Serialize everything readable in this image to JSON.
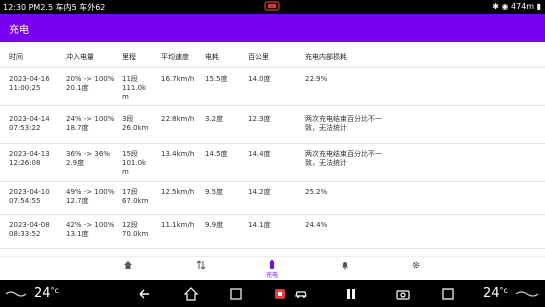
{
  "status_bar": {
    "left": "12:30 PM2.5 车内5 车外62",
    "right": "474m"
  },
  "app_bar": {
    "title": "充电"
  },
  "table": {
    "headers": [
      "时间",
      "冲入电量",
      "里程",
      "平均速度",
      "电耗",
      "百公里",
      "充电内部损耗"
    ],
    "rows": [
      {
        "date": "2023-04-16",
        "time": "11:00:25",
        "charge_pct": "20% -> 100%",
        "charge_amt": "20.1度",
        "mileage_seg": "11段",
        "mileage_km": "111.0k",
        "mileage_km2": "m",
        "speed": "16.7km/h",
        "consumption": "15.5度",
        "per100": "14.0度",
        "loss": "22.9%",
        "note": ""
      },
      {
        "date": "2023-04-14",
        "time": "07:53:22",
        "charge_pct": "24% -> 100%",
        "charge_amt": "18.7度",
        "mileage_seg": "3段",
        "mileage_km": "26.0km",
        "mileage_km2": "",
        "speed": "22.8km/h",
        "consumption": "3.2度",
        "per100": "12.3度",
        "loss": "",
        "note": "两次充电结束百分比不一致，无法统计"
      },
      {
        "date": "2023-04-13",
        "time": "12:26:08",
        "charge_pct": "36% -> 36%",
        "charge_amt": "2.9度",
        "mileage_seg": "15段",
        "mileage_km": "101.0k",
        "mileage_km2": "m",
        "speed": "13.4km/h",
        "consumption": "14.5度",
        "per100": "14.4度",
        "loss": "",
        "note": "两次充电结束百分比不一致，无法统计"
      },
      {
        "date": "2023-04-10",
        "time": "07:54:55",
        "charge_pct": "49% -> 100%",
        "charge_amt": "12.7度",
        "mileage_seg": "17段",
        "mileage_km": "67.0km",
        "mileage_km2": "",
        "speed": "12.5km/h",
        "consumption": "9.5度",
        "per100": "14.2度",
        "loss": "25.2%",
        "note": ""
      },
      {
        "date": "2023-04-08",
        "time": "08:33:52",
        "charge_pct": "42% -> 100%",
        "charge_amt": "13.1度",
        "mileage_seg": "12段",
        "mileage_km": "70.0km",
        "mileage_km2": "",
        "speed": "11.1km/h",
        "consumption": "9.9度",
        "per100": "14.1度",
        "loss": "24.4%",
        "note": ""
      }
    ]
  },
  "bottom_nav": [
    {
      "icon": "home-icon",
      "label": ""
    },
    {
      "icon": "swap-icon",
      "label": ""
    },
    {
      "icon": "battery-icon",
      "label": "充电",
      "active": true
    },
    {
      "icon": "bell-icon",
      "label": ""
    },
    {
      "icon": "gear-icon",
      "label": ""
    }
  ],
  "system_bar": {
    "temp_left": "24",
    "temp_right": "24",
    "unit": "°c"
  },
  "colors": {
    "accent": "#7a00f0",
    "active": "#6f12e8"
  }
}
